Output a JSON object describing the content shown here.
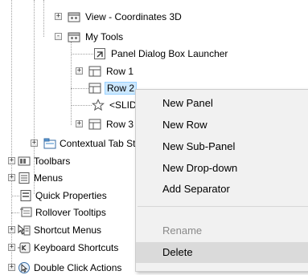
{
  "tree": {
    "items": [
      {
        "label": "View - Coordinates 3D",
        "icon": "panel-icon",
        "expander": "+"
      },
      {
        "label": "My Tools",
        "icon": "panel-icon",
        "expander": "-"
      },
      {
        "label": "Panel Dialog Box Launcher",
        "icon": "dialog-launcher-icon",
        "expander": ""
      },
      {
        "label": "Row 1",
        "icon": "row-icon",
        "expander": "+"
      },
      {
        "label": "Row 2",
        "icon": "row-icon",
        "expander": "",
        "selected": true
      },
      {
        "label": "<SLIDEOUT>",
        "icon": "star-icon",
        "expander": ""
      },
      {
        "label": "Row 3",
        "icon": "row-icon",
        "expander": "+"
      },
      {
        "label": "Contextual Tab States",
        "icon": "contextual-tab-icon",
        "expander": "+"
      },
      {
        "label": "Toolbars",
        "icon": "toolbar-icon",
        "expander": "+"
      },
      {
        "label": "Menus",
        "icon": "menu-icon",
        "expander": "+"
      },
      {
        "label": "Quick Properties",
        "icon": "quick-properties-icon",
        "expander": ""
      },
      {
        "label": "Rollover Tooltips",
        "icon": "tooltip-icon",
        "expander": ""
      },
      {
        "label": "Shortcut Menus",
        "icon": "shortcut-menu-icon",
        "expander": "+"
      },
      {
        "label": "Keyboard Shortcuts",
        "icon": "keyboard-icon",
        "expander": "+"
      },
      {
        "label": "Double Click Actions",
        "icon": "double-click-icon",
        "expander": "+"
      }
    ]
  },
  "context_menu": {
    "items": [
      {
        "label": "New Panel",
        "enabled": true
      },
      {
        "label": "New Row",
        "enabled": true
      },
      {
        "label": "New Sub-Panel",
        "enabled": true
      },
      {
        "label": "New Drop-down",
        "enabled": true
      },
      {
        "label": "Add Separator",
        "enabled": true
      },
      {
        "label": "Rename",
        "enabled": false
      },
      {
        "label": "Delete",
        "enabled": true,
        "hover": true
      }
    ]
  },
  "colors": {
    "selection": "#cce8ff",
    "menu_background": "#f1f1f1",
    "menu_hover": "#dadada",
    "disabled_text": "#8a8a8a"
  }
}
